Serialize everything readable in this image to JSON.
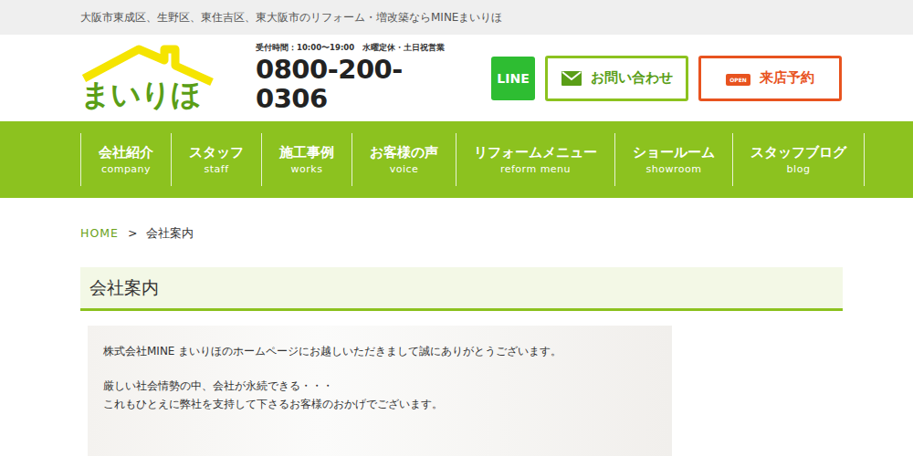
{
  "top_bar": {
    "text": "大阪市東成区、生野区、東住吉区、東大阪市のリフォーム・増改築ならMINEまいりほ"
  },
  "header": {
    "logo": "まいりほ",
    "hours": "受付時間：10:00〜19:00　水曜定休・土日祝営業",
    "phone": "0800-200-0306",
    "buttons": [
      {
        "label": "LINE",
        "kind": "line"
      },
      {
        "label": "お問い合わせ",
        "kind": "contact"
      },
      {
        "label": "来店予約",
        "kind": "visit",
        "badge": "OPEN"
      }
    ]
  },
  "nav": [
    {
      "label": "会社紹介",
      "sub": "company"
    },
    {
      "label": "スタッフ",
      "sub": "staff"
    },
    {
      "label": "施工事例",
      "sub": "works"
    },
    {
      "label": "お客様の声",
      "sub": "voice"
    },
    {
      "label": "リフォームメニュー",
      "sub": "reform menu"
    },
    {
      "label": "ショールーム",
      "sub": "showroom"
    },
    {
      "label": "スタッフブログ",
      "sub": "blog"
    }
  ],
  "breadcrumb": [
    {
      "label": "HOME",
      "link": true
    },
    {
      "label": ">",
      "link": false
    },
    {
      "label": "会社案内",
      "link": false
    }
  ],
  "page_title": "会社案内",
  "paragraphs": [
    [
      "株式会社MINE まいりほのホームページにお越しいただきまして誠にありがとうございます。"
    ],
    [
      "厳しい社会情勢の中、会社が永続できる・・・",
      "これもひとえに弊社を支持して下さるお客様のおかげでございます。"
    ]
  ]
}
